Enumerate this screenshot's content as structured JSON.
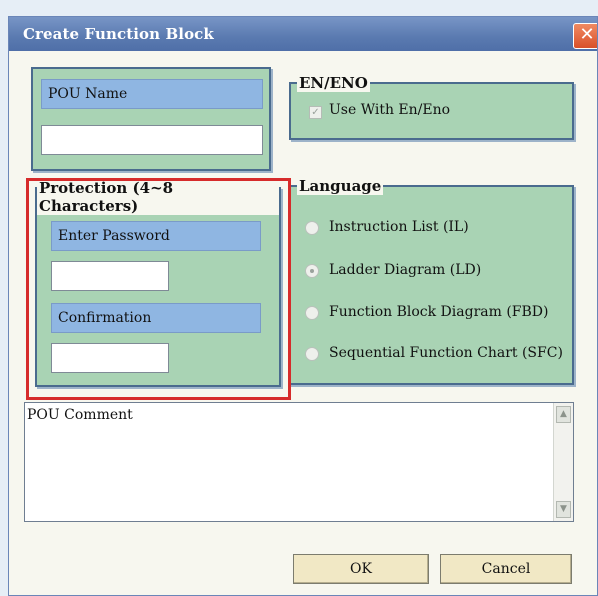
{
  "window": {
    "title": "Create Function Block",
    "close_glyph": "✕"
  },
  "pou_name": {
    "label": "POU Name",
    "value": ""
  },
  "en_eno": {
    "title": "EN/ENO",
    "checkbox_label": "Use With En/Eno",
    "checked": true
  },
  "protection": {
    "title": "Protection (4~8 Characters)",
    "enter_password_label": "Enter Password",
    "enter_password_value": "",
    "confirmation_label": "Confirmation",
    "confirmation_value": ""
  },
  "language": {
    "title": "Language",
    "options": [
      {
        "label": "Instruction List (IL)",
        "selected": false
      },
      {
        "label": "Ladder Diagram (LD)",
        "selected": true
      },
      {
        "label": "Function Block Diagram (FBD)",
        "selected": false
      },
      {
        "label": "Sequential Function Chart (SFC)",
        "selected": false
      }
    ]
  },
  "comment": {
    "placeholder_text": "POU Comment",
    "scroll_up": "▲",
    "scroll_down": "▼"
  },
  "buttons": {
    "ok": "OK",
    "cancel": "Cancel"
  },
  "colors": {
    "group_fill": "#a9d3b4",
    "label_fill": "#8fb6e2",
    "highlight": "#d62b2b",
    "titlebar": "#5a7ab0"
  }
}
